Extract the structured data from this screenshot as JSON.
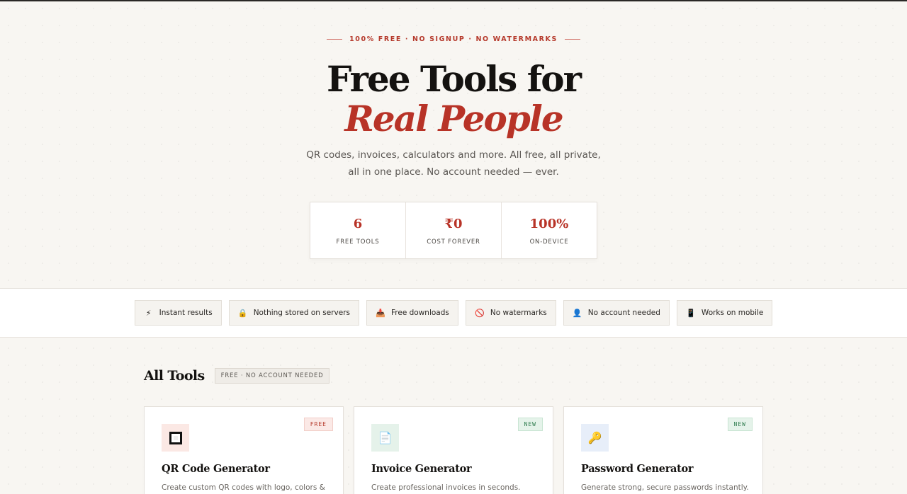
{
  "hero": {
    "eyebrow": "100% FREE · NO SIGNUP · NO WATERMARKS",
    "title_line1": "Free Tools for",
    "title_line2": "Real People",
    "subtitle": "QR codes, invoices, calculators and more. All free, all private, all in one place. No account needed — ever."
  },
  "stats": [
    {
      "value": "6",
      "label": "FREE TOOLS"
    },
    {
      "value": "₹0",
      "label": "COST FOREVER"
    },
    {
      "value": "100%",
      "label": "ON-DEVICE"
    }
  ],
  "features": [
    {
      "icon": "lightning-icon",
      "glyph": "⚡",
      "label": "Instant results"
    },
    {
      "icon": "lock-icon",
      "glyph": "🔒",
      "label": "Nothing stored on servers"
    },
    {
      "icon": "download-icon",
      "glyph": "📥",
      "label": "Free downloads"
    },
    {
      "icon": "no-entry-icon",
      "glyph": "🚫",
      "label": "No watermarks"
    },
    {
      "icon": "user-icon",
      "glyph": "👤",
      "label": "No account needed"
    },
    {
      "icon": "mobile-icon",
      "glyph": "📱",
      "label": "Works on mobile"
    }
  ],
  "tools_section": {
    "title": "All Tools",
    "badge": "FREE · NO ACCOUNT NEEDED"
  },
  "tools": [
    {
      "tag": "FREE",
      "tag_style": "free",
      "icon": "qr-code-icon",
      "title": "QR Code Generator",
      "description": "Create custom QR codes with logo, colors &"
    },
    {
      "tag": "NEW",
      "tag_style": "new",
      "icon": "invoice-icon",
      "glyph": "📄",
      "title": "Invoice Generator",
      "description": "Create professional invoices in seconds."
    },
    {
      "tag": "NEW",
      "tag_style": "new",
      "icon": "key-icon",
      "glyph": "🔑",
      "title": "Password Generator",
      "description": "Generate strong, secure passwords instantly."
    }
  ],
  "colors": {
    "accent": "#b83327",
    "background": "#f8f6f2",
    "new_tag": "#2f7d4f"
  }
}
